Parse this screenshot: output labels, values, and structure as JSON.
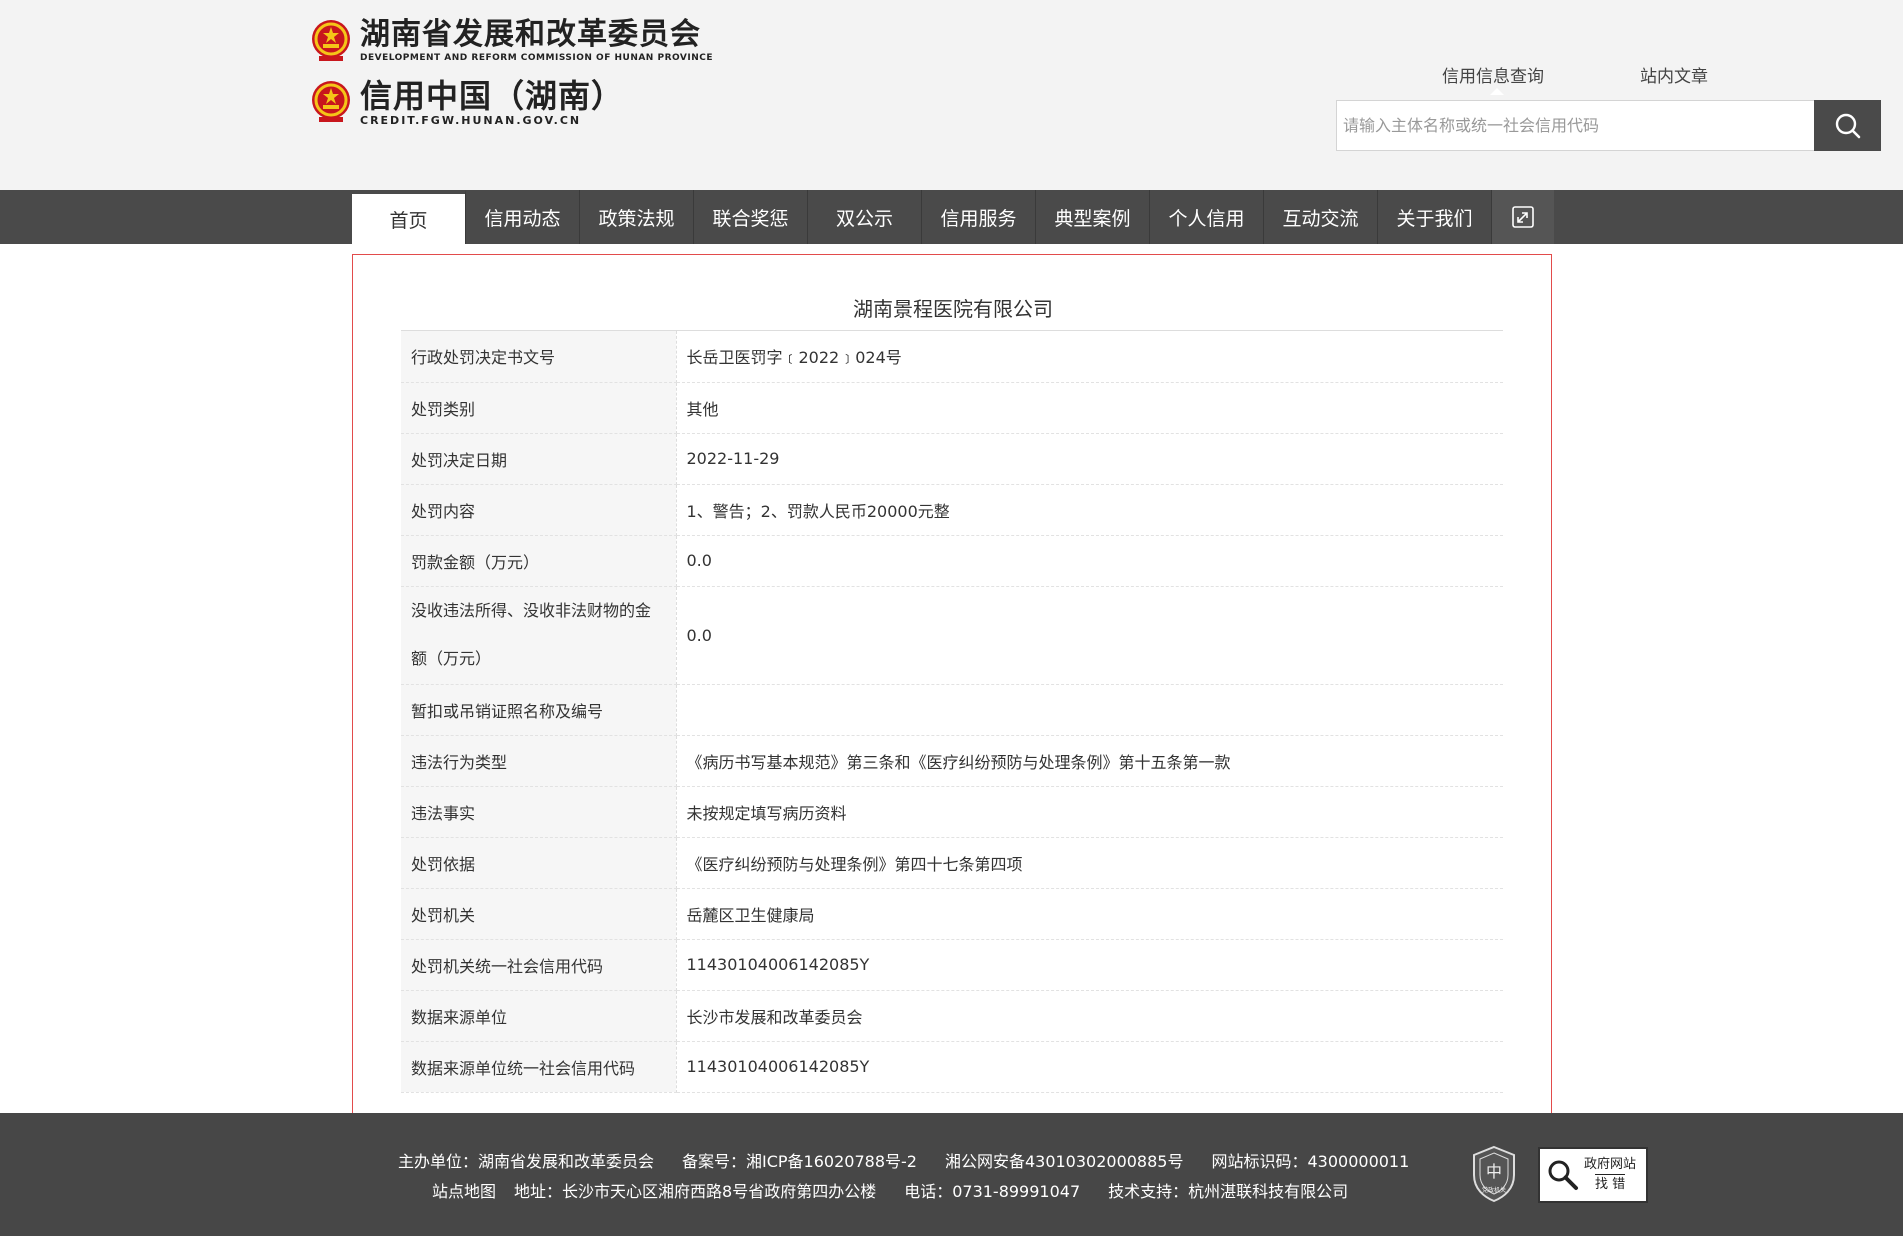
{
  "header": {
    "logo1": {
      "cn": "湖南省发展和改革委员会",
      "en": "DEVELOPMENT AND REFORM COMMISSION OF HUNAN PROVINCE"
    },
    "logo2": {
      "cn": "信用中国（湖南）",
      "en": "CREDIT.FGW.HUNAN.GOV.CN"
    },
    "search": {
      "tab_active": "信用信息查询",
      "tab_other": "站内文章",
      "placeholder": "请输入主体名称或统一社会信用代码"
    }
  },
  "nav": {
    "items": [
      "首页",
      "信用动态",
      "政策法规",
      "联合奖惩",
      "双公示",
      "信用服务",
      "典型案例",
      "个人信用",
      "互动交流",
      "关于我们"
    ]
  },
  "detail": {
    "title": "湖南景程医院有限公司",
    "rows": [
      {
        "label": "行政处罚决定书文号",
        "value": "长岳卫医罚字﹝2022﹞024号"
      },
      {
        "label": "处罚类别",
        "value": "其他"
      },
      {
        "label": "处罚决定日期",
        "value": "2022-11-29"
      },
      {
        "label": "处罚内容",
        "value": "1、警告；2、罚款人民币20000元整"
      },
      {
        "label": "罚款金额（万元）",
        "value": "0.0"
      },
      {
        "label": "没收违法所得、没收非法财物的金额（万元）",
        "value": "0.0"
      },
      {
        "label": "暂扣或吊销证照名称及编号",
        "value": ""
      },
      {
        "label": "违法行为类型",
        "value": "《病历书写基本规范》第三条和《医疗纠纷预防与处理条例》第十五条第一款"
      },
      {
        "label": "违法事实",
        "value": "未按规定填写病历资料"
      },
      {
        "label": "处罚依据",
        "value": "《医疗纠纷预防与处理条例》第四十七条第四项"
      },
      {
        "label": "处罚机关",
        "value": "岳麓区卫生健康局"
      },
      {
        "label": "处罚机关统一社会信用代码",
        "value": "11430104006142085Y"
      },
      {
        "label": "数据来源单位",
        "value": "长沙市发展和改革委员会"
      },
      {
        "label": "数据来源单位统一社会信用代码",
        "value": "11430104006142085Y"
      }
    ]
  },
  "footer": {
    "sponsor": "主办单位：湖南省发展和改革委员会",
    "icp": "备案号：湘ICP备16020788号-2",
    "police": "湘公网安备43010302000885号",
    "site_id": "网站标识码：4300000011",
    "sitemap": "站点地图",
    "address": "地址：长沙市天心区湘府西路8号省政府第四办公楼",
    "phone": "电话：0731-89991047",
    "support": "技术支持：杭州湛联科技有限公司",
    "badge1": "党政机关",
    "badge2_top": "政府网站",
    "badge2_bottom": "找 错"
  }
}
